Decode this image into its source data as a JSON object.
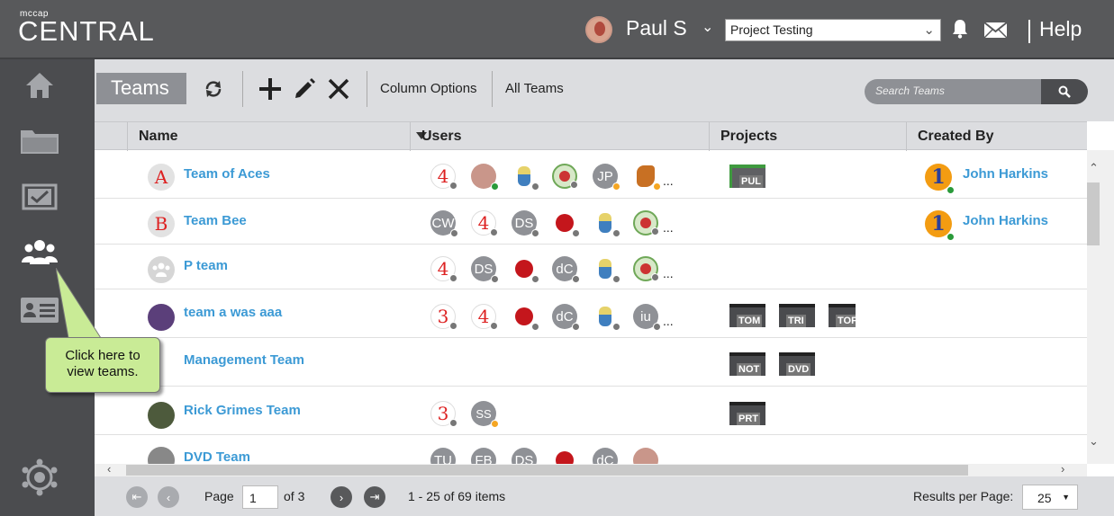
{
  "header": {
    "brand_small": "mccap",
    "brand": "CENTRAL",
    "user_name": "Paul S",
    "project": "Project Testing",
    "help": "Help"
  },
  "toolbar": {
    "tab_label": "Teams",
    "column_options": "Column Options",
    "filter_view": "All Teams",
    "search_placeholder": "Search Teams"
  },
  "columns": [
    "Name",
    "Users",
    "Projects",
    "Created By"
  ],
  "teams": [
    {
      "name": "Team of Aces",
      "avatar_text": "A",
      "users": [
        "4",
        "photo",
        "figure",
        "badge",
        "JP",
        "fox"
      ],
      "projects": [
        "PUL"
      ],
      "created_by": "John Harkins"
    },
    {
      "name": "Team Bee",
      "avatar_text": "B",
      "users": [
        "CW",
        "4",
        "DS",
        "apple",
        "figure",
        "badge"
      ],
      "projects": [],
      "created_by": "John Harkins"
    },
    {
      "name": "P team",
      "avatar_text": "",
      "users": [
        "4",
        "DS",
        "apple",
        "dC",
        "figure",
        "badge"
      ],
      "projects": [],
      "created_by": ""
    },
    {
      "name": "team a was aaa",
      "avatar_text": "",
      "users": [
        "3",
        "4",
        "apple",
        "dC",
        "figure",
        "iu"
      ],
      "projects": [
        "TOM",
        "TRI",
        "TOF"
      ],
      "created_by": ""
    },
    {
      "name": "Management Team",
      "avatar_text": "",
      "users": [],
      "projects": [
        "NOT",
        "DVD"
      ],
      "created_by": ""
    },
    {
      "name": "Rick Grimes Team",
      "avatar_text": "",
      "users": [
        "3",
        "SS"
      ],
      "projects": [
        "PRT"
      ],
      "created_by": ""
    },
    {
      "name": "DVD Team",
      "avatar_text": "",
      "users": [
        "TU",
        "FB",
        "DS",
        "apple",
        "dC",
        "photo"
      ],
      "projects": [],
      "created_by": ""
    }
  ],
  "creator_avatar_text": "1",
  "ellipsis": "...",
  "pager": {
    "page_label": "Page",
    "page_value": "1",
    "of_label": "of 3",
    "items_summary": "1 - 25 of 69 items",
    "results_label": "Results per Page:",
    "results_value": "25"
  },
  "callout": {
    "line1": "Click here to",
    "line2": "view teams."
  },
  "colors": {
    "header_bg": "#58595b",
    "sidebar_bg": "#4b4c4f",
    "link": "#3c9ad5",
    "callout_bg": "#c9eb96"
  }
}
